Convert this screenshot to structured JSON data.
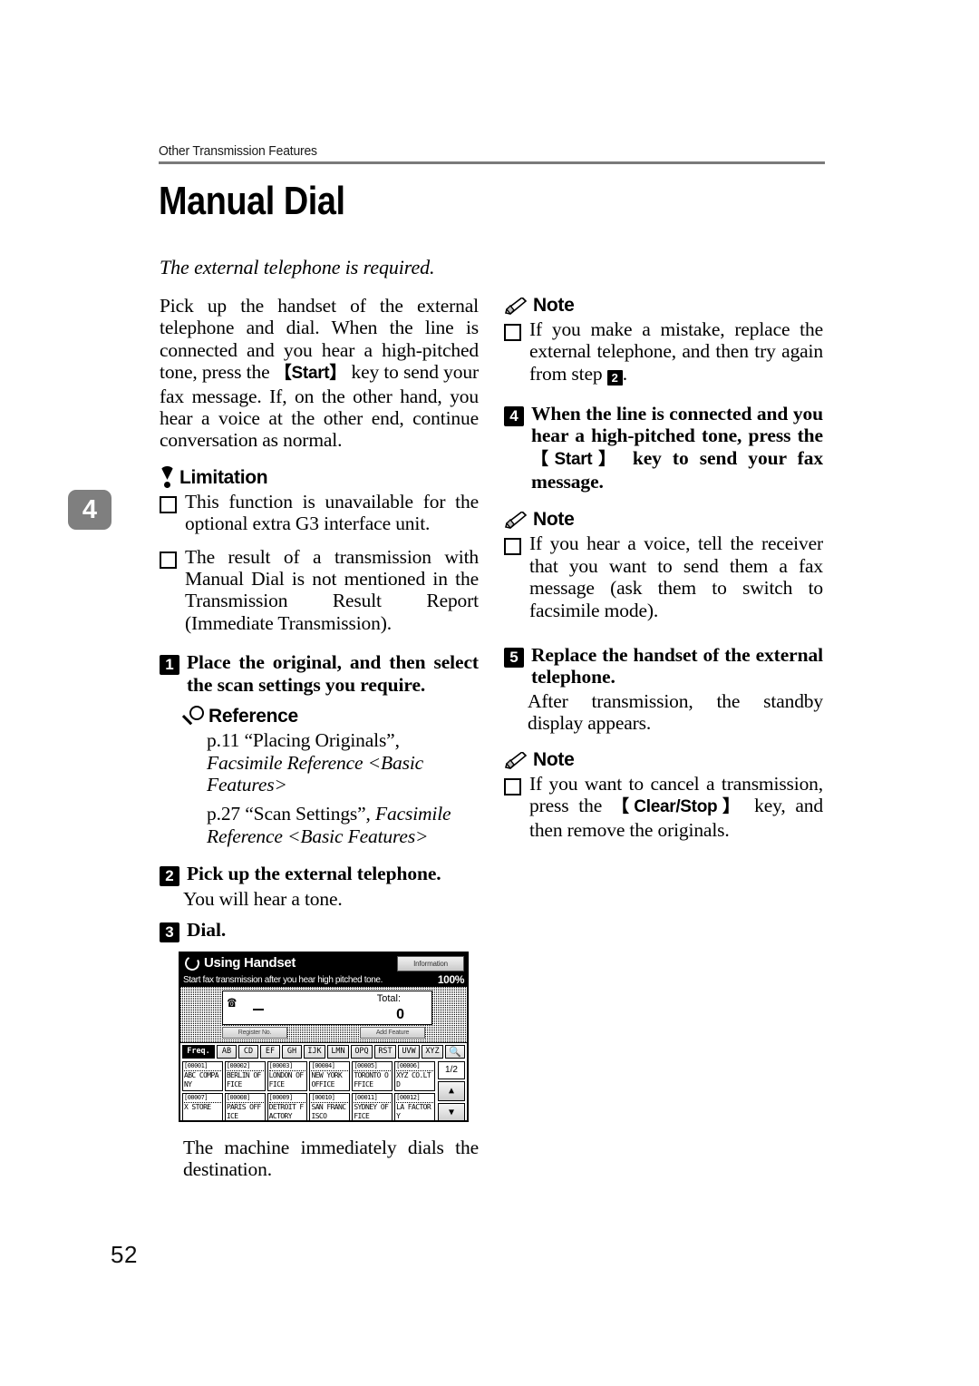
{
  "page": {
    "running_header": "Other Transmission Features",
    "title": "Manual Dial",
    "intro_italic": "The external telephone is required.",
    "chapter_tab": "4",
    "folio": "52"
  },
  "left_column": {
    "intro_paragraph_1": "Pick up the handset of the external telephone and dial. When the line is connected and you hear a high-pitched tone, press the ",
    "intro_keycap": "【Start】",
    "intro_paragraph_2": " key to send your fax message. If, on the other hand, you hear a voice at the other end, continue conversation as normal.",
    "limitation_head": "Limitation",
    "limitation_items": [
      "This function is unavailable for the optional extra G3 interface unit.",
      "The result of a transmission with Manual Dial is not mentioned in the Transmission Result Report (Immediate Transmission)."
    ],
    "step1_num": "A",
    "step1_text": "Place the original, and then select the scan settings you require.",
    "reference_head": "Reference",
    "reference_items": [
      {
        "roman": "p.11 “Placing Originals”, ",
        "italic": "Facsimile Reference <Basic Features>"
      },
      {
        "roman": "p.27 “Scan Settings”, ",
        "italic": "Facsimile Reference <Basic Features>"
      }
    ],
    "step2_num": "B",
    "step2_text": "Pick up the external telephone.",
    "step2_body": "You will hear a tone.",
    "step3_num": "C",
    "step3_text": "Dial.",
    "step3_body": "The machine immediately dials the destination."
  },
  "right_column": {
    "note1_head": "Note",
    "note1_text_a": "If you make a mistake, replace the external telephone, and then try again from step ",
    "note1_step_ref": "B",
    "note1_text_b": ".",
    "step4_num": "D",
    "step4_text_a": "When the line is connected and you hear a high-pitched tone, press the ",
    "step4_keycap": "【Start】",
    "step4_text_b": " key to send your fax message.",
    "note2_head": "Note",
    "note2_text": "If you hear a voice, tell the receiver that you want to send them a fax message (ask them to switch to facsimile mode).",
    "step5_num": "E",
    "step5_text": "Replace the handset of the external telephone.",
    "step5_body": "After transmission, the standby display appears.",
    "note3_head": "Note",
    "note3_text_a": "If you want to cancel a transmission, press the ",
    "note3_keycap": "【Clear/Stop】",
    "note3_text_b": " key, and then remove the originals."
  },
  "lcd": {
    "title": "Using Handset",
    "information_button": "Information",
    "status_message": "Start fax transmission after you hear high pitched tone.",
    "zoom_level": "100%",
    "destination_value": "",
    "total_label": "Total:",
    "total_value": "0",
    "sub_buttons": [
      "Register No.",
      "Add Feature"
    ],
    "alpha_tabs": [
      "Freq.",
      "AB",
      "CD",
      "EF",
      "GH",
      "IJK",
      "LMN",
      "OPQ",
      "RST",
      "UVW",
      "XYZ"
    ],
    "search_icon": "search-icon",
    "page_indicator": "1/2",
    "scroll_up": "▲",
    "scroll_down": "▼",
    "entries": [
      {
        "id": "[00001]",
        "name": "ABC COMPANY"
      },
      {
        "id": "[00002]",
        "name": "BERLIN OFFICE"
      },
      {
        "id": "[00003]",
        "name": "LONDON OFFICE"
      },
      {
        "id": "[00004]",
        "name": "NEW YORK OFFICE"
      },
      {
        "id": "[00005]",
        "name": "TORONTO OFFICE"
      },
      {
        "id": "[00006]",
        "name": "XYZ CO.LTD"
      },
      {
        "id": "[00007]",
        "name": "X STORE"
      },
      {
        "id": "[00008]",
        "name": "PARIS OFFICE"
      },
      {
        "id": "[00009]",
        "name": "DETROIT FACTORY"
      },
      {
        "id": "[00010]",
        "name": "SAN FRANCISCO"
      },
      {
        "id": "[00011]",
        "name": "SYDNEY OFFICE"
      },
      {
        "id": "[00012]",
        "name": "LA FACTORY"
      }
    ]
  },
  "colors": {
    "chapter_tab_bg": "#7f7f7f",
    "rule": "#7a7a7a",
    "ink": "#000000"
  }
}
